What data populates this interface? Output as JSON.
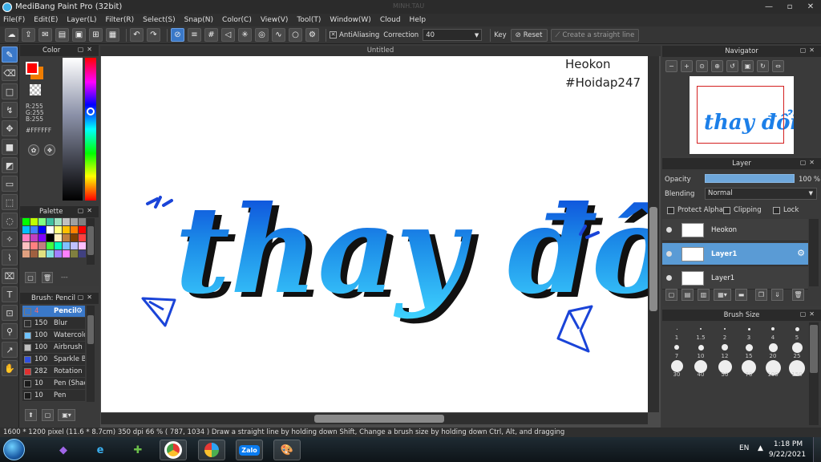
{
  "window": {
    "title": "MediBang Paint Pro (32bit)",
    "ghost_text": "MINH.TAU",
    "controls": [
      "—",
      "▫",
      "✕"
    ]
  },
  "menu": [
    "File(F)",
    "Edit(E)",
    "Layer(L)",
    "Filter(R)",
    "Select(S)",
    "Snap(N)",
    "Color(C)",
    "View(V)",
    "Tool(T)",
    "Window(W)",
    "Cloud",
    "Help"
  ],
  "toolbar": {
    "antialiasing_label": "AntiAliasing",
    "correction_label": "Correction",
    "correction_value": "40",
    "key_label": "Key",
    "reset_label": "Reset",
    "straight_line_label": "Create a straight line"
  },
  "color_panel": {
    "title": "Color",
    "r": "R:255",
    "g": "G:255",
    "b": "B:255",
    "hex": "#FFFFFF",
    "fg_color": "#ff0000",
    "bg_color": "#f07d00"
  },
  "palette_panel": {
    "title": "Palette",
    "extra": "---",
    "colors": [
      "#00ff00",
      "#c0ff00",
      "#80ff80",
      "#40c0a0",
      "#a0e0c0",
      "#c0c0c0",
      "#a0a0a0",
      "#808080",
      "#00c0ff",
      "#4080ff",
      "#0000ff",
      "#ffffff",
      "#ffff80",
      "#ffc000",
      "#ff8000",
      "#ff0000",
      "#ff80c0",
      "#c040c0",
      "#8000ff",
      "#000000",
      "#fff0c0",
      "#c08040",
      "#804000",
      "#ff4040",
      "#ffc0c0",
      "#ff8080",
      "#c08080",
      "#40ff40",
      "#00ffc0",
      "#80c0ff",
      "#c0c0ff",
      "#ffc0ff",
      "#e0a080",
      "#a06040",
      "#e0e080",
      "#80e0e0",
      "#a080ff",
      "#ff80ff",
      "#808040",
      "#404080"
    ]
  },
  "brush_panel": {
    "title": "Brush: Pencil",
    "brushes": [
      {
        "size": "4",
        "name": "Pencil",
        "color": "#3a78c8",
        "active": true
      },
      {
        "size": "150",
        "name": "Blur",
        "color": "#2e2e2e",
        "active": false
      },
      {
        "size": "100",
        "name": "Watercolor",
        "color": "#6fc3ff",
        "active": false
      },
      {
        "size": "100",
        "name": "Airbrush",
        "color": "#c0c0c0",
        "active": false
      },
      {
        "size": "100",
        "name": "Sparkle Brush",
        "color": "#3050e0",
        "active": false
      },
      {
        "size": "282",
        "name": "Rotation",
        "color": "#e03030",
        "active": false
      },
      {
        "size": "10",
        "name": "Pen (Shading)",
        "color": "#1a1a1a",
        "active": false
      },
      {
        "size": "10",
        "name": "Pen",
        "color": "#1a1a1a",
        "active": false
      }
    ]
  },
  "canvas": {
    "tab_title": "Untitled",
    "watermark_name": "Heokon",
    "watermark_tag": "#Hoidap247",
    "artwork_text": "thay đổi"
  },
  "navigator": {
    "title": "Navigator",
    "thumb_text": "thay đổi"
  },
  "layer_panel": {
    "title": "Layer",
    "opacity_label": "Opacity",
    "opacity_value": "100 %",
    "opacity_percent": 100,
    "blending_label": "Blending",
    "blending_value": "Normal",
    "protect_alpha": "Protect Alpha",
    "clipping": "Clipping",
    "lock": "Lock",
    "layers": [
      {
        "name": "Heokon",
        "active": false
      },
      {
        "name": "Layer1",
        "active": true
      },
      {
        "name": "Layer1",
        "active": false
      }
    ]
  },
  "brush_size_panel": {
    "title": "Brush Size",
    "sizes": [
      "1",
      "1.5",
      "2",
      "3",
      "4",
      "5",
      "7",
      "10",
      "12",
      "15",
      "20",
      "25",
      "30",
      "40",
      "50",
      "70",
      "100",
      "150"
    ]
  },
  "status": {
    "text": "1600 * 1200 pixel  (11.6 * 8.7cm)  350 dpi  66 %  ( 787, 1034 )  Draw a straight line by holding down Shift, Change a brush size by holding down Ctrl, Alt, and dragging"
  },
  "taskbar": {
    "lang": "EN",
    "time": "1:18 PM",
    "date": "9/22/2021",
    "apps": [
      "visual-studio",
      "internet-explorer",
      "app-green",
      "chrome",
      "app-pinwheel",
      "zalo",
      "medibang"
    ],
    "zalo_label": "Zalo"
  }
}
